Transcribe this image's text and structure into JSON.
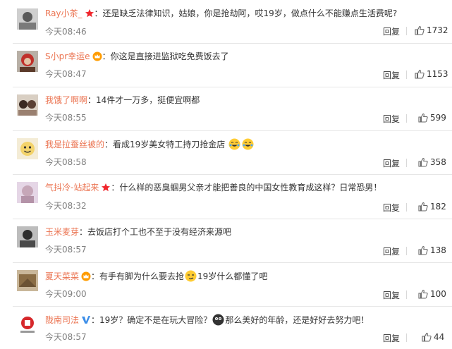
{
  "separator": "：",
  "reply_label": "回复",
  "comments": [
    {
      "user": "Ray小茶_",
      "badge": "star-badge",
      "text": "还是缺乏法律知识，姑娘，你是抢劫阿，哎19岁，做点什么不能赚点生活费呢?",
      "time": "今天08:46",
      "likes": "1732"
    },
    {
      "user": "S小pr幸运e",
      "badge": "crown-badge",
      "text": "你这是直接进监狱吃免费饭去了",
      "time": "今天08:47",
      "likes": "1153"
    },
    {
      "user": "我饿了啊啊",
      "text": "14件才一万多，挺便宜啊都",
      "time": "今天08:55",
      "likes": "599"
    },
    {
      "user": "我是拉蚕丝被的",
      "text": "看成19岁美女特工持刀抢金店",
      "time": "今天08:58",
      "likes": "358"
    },
    {
      "user": "气抖冷-站起来",
      "badge": "star-badge",
      "text": "什么样的恶臭蝈男父亲才能把善良的中国女性教育成这样？日常恐男！",
      "time": "今天08:32",
      "likes": "182"
    },
    {
      "user": "玉米麦芽",
      "text": "去饭店打个工也不至于没有经济来源吧",
      "time": "今天08:57",
      "likes": "138"
    },
    {
      "user": "夏天菜菜",
      "badge": "crown-badge",
      "text_a": "有手有脚为什么要去抢",
      "text_b": "19岁什么都懂了吧",
      "time": "今天09:00",
      "likes": "100"
    },
    {
      "user": "陇南司法",
      "badge": "verified-badge",
      "text_a": "19岁？确定不是在玩大冒险？",
      "text_b": "那么美好的年龄，还是好好去努力吧！",
      "time": "今天08:57",
      "likes": "44"
    }
  ]
}
